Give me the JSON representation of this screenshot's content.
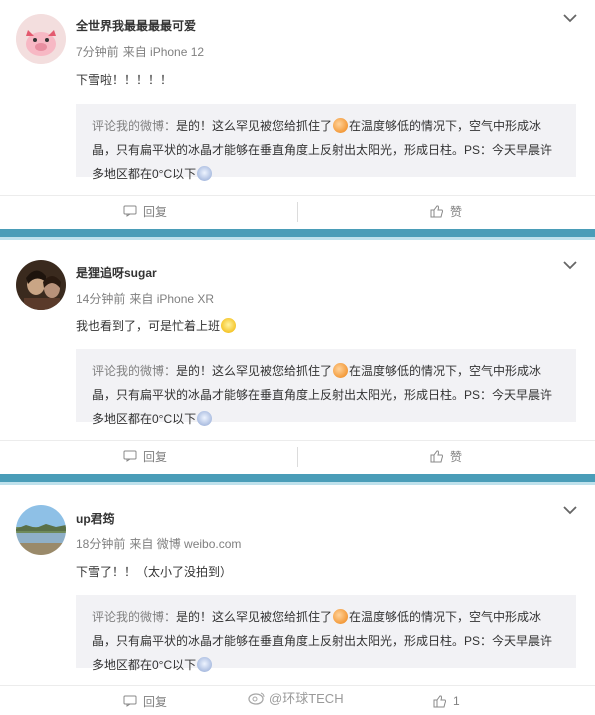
{
  "comments": [
    {
      "username": "全世界我最最最最可爱",
      "time": "7分钟前",
      "source": "来自 iPhone 12",
      "text": "下雪啦！！！！！",
      "quote_label": "评论我的微博：",
      "quote_line1": "是的！这么罕见被您给抓住了",
      "quote_line1b": "在温度够低的情况下，空气中形成冰",
      "quote_line2": "晶，只有扁平状的冰晶才能够在垂直角度上反射出太阳光，形成日柱。PS：今天早晨许",
      "quote_line3": "多地区都在0°C以下",
      "reply_label": "回复",
      "like_label": "赞"
    },
    {
      "username": "是狸追呀sugar",
      "time": "14分钟前",
      "source": "来自 iPhone XR",
      "text": "我也看到了，可是忙着上班",
      "quote_label": "评论我的微博：",
      "quote_line1": "是的！这么罕见被您给抓住了",
      "quote_line1b": "在温度够低的情况下，空气中形成冰",
      "quote_line2": "晶，只有扁平状的冰晶才能够在垂直角度上反射出太阳光，形成日柱。PS：今天早晨许",
      "quote_line3": "多地区都在0°C以下",
      "reply_label": "回复",
      "like_label": "赞"
    },
    {
      "username": "up君筠",
      "time": "18分钟前",
      "source": "来自 微博 weibo.com",
      "text": "下雪了！！（太小了没拍到）",
      "quote_label": "评论我的微博：",
      "quote_line1": "是的！这么罕见被您给抓住了",
      "quote_line1b": "在温度够低的情况下，空气中形成冰",
      "quote_line2": "晶，只有扁平状的冰晶才能够在垂直角度上反射出太阳光，形成日柱。PS：今天早晨许",
      "quote_line3": "多地区都在0°C以下",
      "reply_label": "回复",
      "like_label": "1"
    }
  ],
  "watermark": "@环球TECH",
  "colors": {
    "separator": "#4a9db8",
    "quote_bg": "#f2f2f5",
    "muted": "#808080"
  }
}
